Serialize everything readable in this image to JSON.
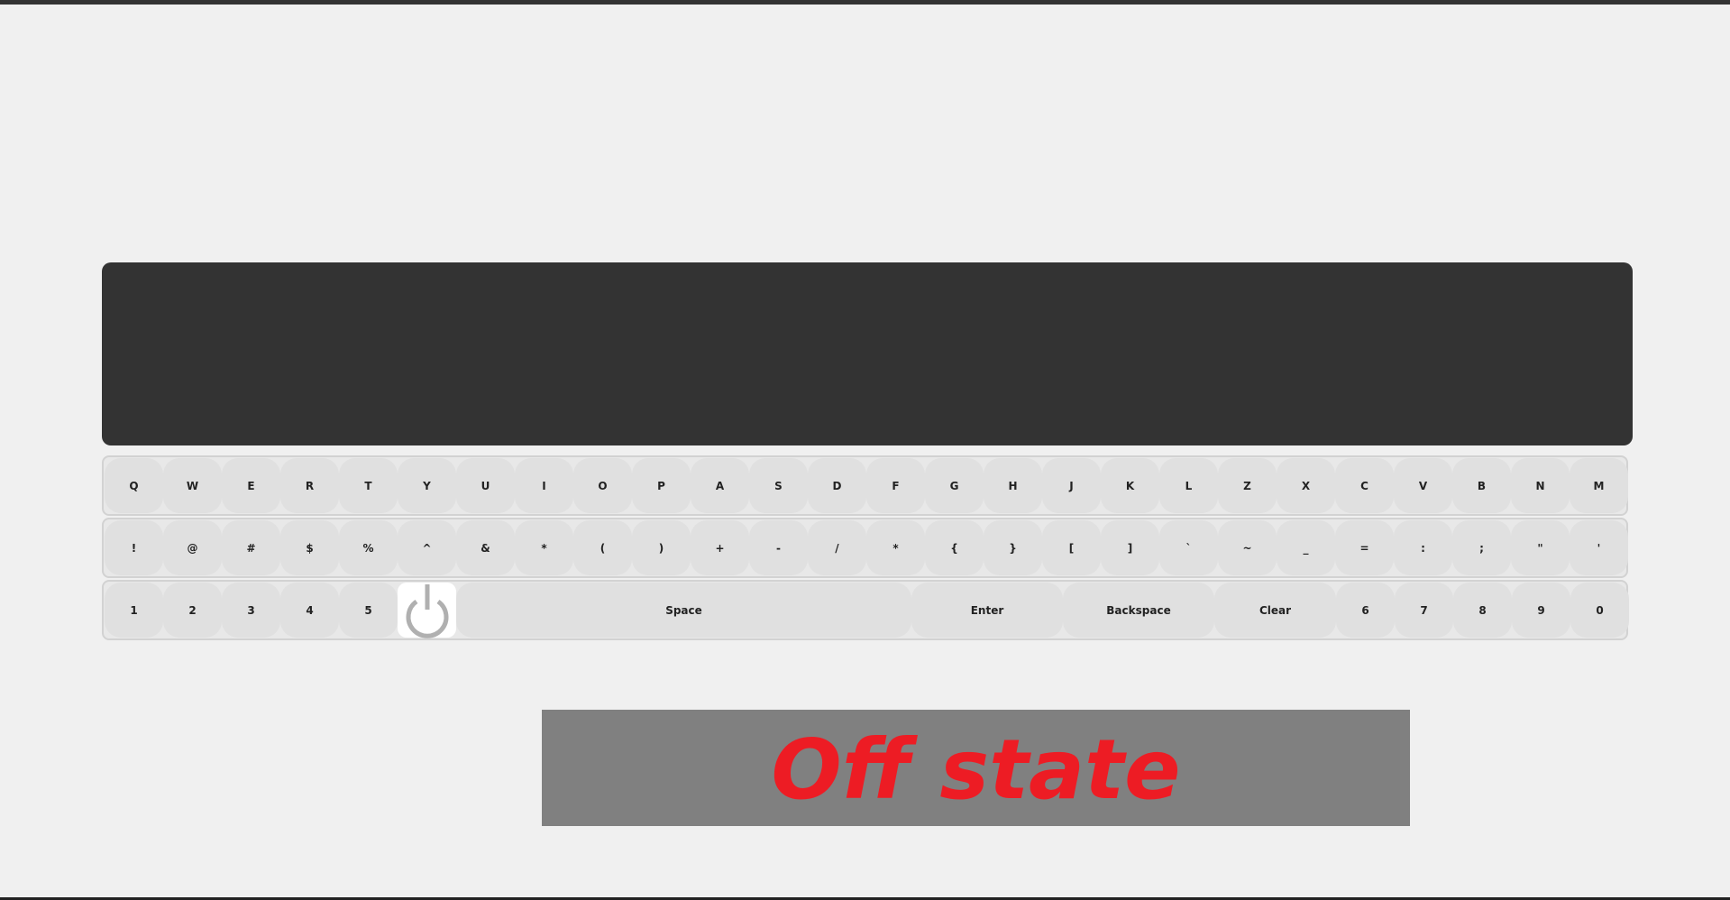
{
  "keyboard": {
    "row1": [
      "Q",
      "W",
      "E",
      "R",
      "T",
      "Y",
      "U",
      "I",
      "O",
      "P",
      "A",
      "S",
      "D",
      "F",
      "G",
      "H",
      "J",
      "K",
      "L",
      "Z",
      "X",
      "C",
      "V",
      "B",
      "N",
      "M"
    ],
    "row2": [
      "!",
      "@",
      "#",
      "$",
      "%",
      "^",
      "&",
      "*",
      "(",
      ")",
      "+",
      "-",
      "/",
      "*",
      "{",
      "}",
      "[",
      "]",
      "`",
      "~",
      "_",
      "=",
      ":",
      ";",
      "\"",
      "'"
    ],
    "row3_left": [
      "1",
      "2",
      "3",
      "4",
      "5"
    ],
    "power_icon": "power-icon",
    "space_label": "Space",
    "enter_label": "Enter",
    "backspace_label": "Backspace",
    "clear_label": "Clear",
    "row3_right": [
      "6",
      "7",
      "8",
      "9",
      "0"
    ]
  },
  "status": {
    "text": "Off state",
    "color": "#ed1c24",
    "background": "#808080"
  },
  "display": {
    "text": ""
  }
}
